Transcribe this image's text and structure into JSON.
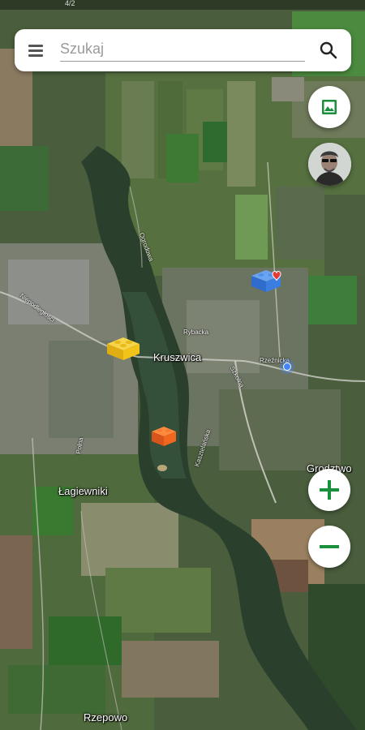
{
  "status_bar": {
    "text": "4/2"
  },
  "search": {
    "placeholder": "Szukaj",
    "value": ""
  },
  "buttons": {
    "layers": "image-icon",
    "zoom_in": "plus-icon",
    "zoom_out": "minus-icon"
  },
  "colors": {
    "accent_green": "#1a8f3c",
    "marker_yellow": "#f2c318",
    "marker_orange": "#f0671f",
    "marker_blue": "#3a7fe0",
    "heart_red": "#e53935",
    "location_blue": "#4285f4"
  },
  "map": {
    "type": "satellite",
    "places": [
      "Kruszwica",
      "Łagiewniki",
      "Rzepowo",
      "Grodztwo"
    ],
    "streets": [
      "Ogrodowa",
      "Niepodległości",
      "Polna",
      "Szkolna",
      "Kasztelańska",
      "Rybacka",
      "Rzeźnicka"
    ],
    "markers": [
      {
        "name": "yellow-block-marker",
        "color": "yellow"
      },
      {
        "name": "orange-block-marker",
        "color": "orange"
      },
      {
        "name": "blue-block-favorite-marker",
        "color": "blue",
        "favorite": true
      }
    ]
  }
}
